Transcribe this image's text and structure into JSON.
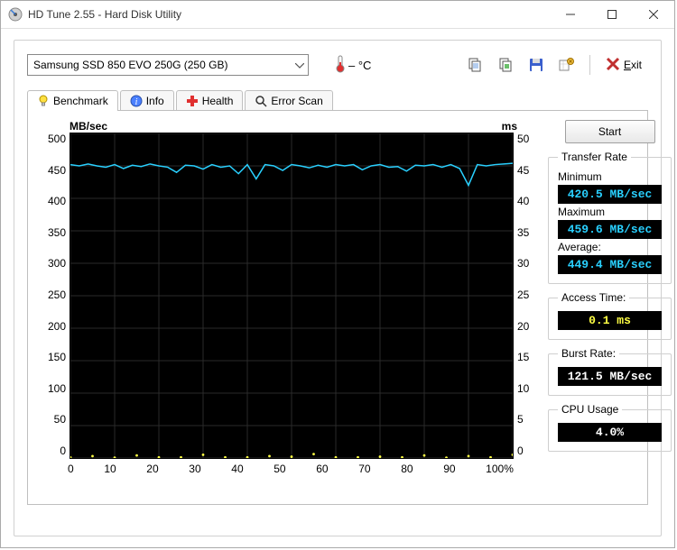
{
  "window": {
    "title": "HD Tune 2.55 - Hard Disk Utility"
  },
  "toolbar": {
    "drive_selected": "Samsung SSD 850 EVO 250G (250 GB)",
    "temperature": "– °C",
    "exit_label": "Exit"
  },
  "tabs": [
    {
      "id": "benchmark",
      "label": "Benchmark",
      "active": true
    },
    {
      "id": "info",
      "label": "Info",
      "active": false
    },
    {
      "id": "health",
      "label": "Health",
      "active": false
    },
    {
      "id": "errorscan",
      "label": "Error Scan",
      "active": false
    }
  ],
  "benchmark": {
    "start_label": "Start",
    "axis_left_label": "MB/sec",
    "axis_right_label": "ms",
    "y_left_ticks": [
      "500",
      "450",
      "400",
      "350",
      "300",
      "250",
      "200",
      "150",
      "100",
      "50",
      "0"
    ],
    "y_right_ticks": [
      "50",
      "45",
      "40",
      "35",
      "30",
      "25",
      "20",
      "15",
      "10",
      "5",
      "0"
    ],
    "x_ticks": [
      "0",
      "10",
      "20",
      "30",
      "40",
      "50",
      "60",
      "70",
      "80",
      "90",
      "100%"
    ],
    "groups": {
      "transfer": {
        "legend": "Transfer Rate",
        "min_label": "Minimum",
        "min_value": "420.5 MB/sec",
        "max_label": "Maximum",
        "max_value": "459.6 MB/sec",
        "avg_label": "Average:",
        "avg_value": "449.4 MB/sec"
      },
      "access": {
        "legend": "Access Time:",
        "value": "0.1 ms"
      },
      "burst": {
        "legend": "Burst Rate:",
        "value": "121.5 MB/sec"
      },
      "cpu": {
        "legend": "CPU Usage",
        "value": "4.0%"
      }
    }
  },
  "chart_data": {
    "type": "line",
    "title": "",
    "xlabel": "%",
    "ylabel_left": "MB/sec",
    "ylabel_right": "ms",
    "xlim": [
      0,
      100
    ],
    "ylim_left": [
      0,
      500
    ],
    "ylim_right": [
      0,
      50
    ],
    "series": [
      {
        "name": "Transfer Rate (MB/sec)",
        "axis": "left",
        "color": "#29d0ff",
        "x": [
          0,
          2,
          4,
          6,
          8,
          10,
          12,
          14,
          16,
          18,
          20,
          22,
          24,
          26,
          28,
          30,
          32,
          34,
          36,
          38,
          40,
          42,
          44,
          46,
          48,
          50,
          52,
          54,
          56,
          58,
          60,
          62,
          64,
          66,
          68,
          70,
          72,
          74,
          76,
          78,
          80,
          82,
          84,
          86,
          88,
          90,
          92,
          94,
          96,
          98,
          100
        ],
        "values": [
          452,
          450,
          453,
          450,
          448,
          452,
          446,
          451,
          449,
          453,
          450,
          448,
          440,
          451,
          450,
          445,
          452,
          448,
          450,
          438,
          452,
          430,
          452,
          450,
          443,
          452,
          450,
          447,
          451,
          448,
          452,
          450,
          452,
          444,
          450,
          452,
          448,
          449,
          442,
          451,
          450,
          452,
          448,
          452,
          446,
          420,
          452,
          450,
          452,
          453,
          454
        ]
      },
      {
        "name": "Access Time (ms)",
        "axis": "right",
        "color": "#ffff44",
        "x": [
          0,
          5,
          10,
          15,
          20,
          25,
          30,
          35,
          40,
          45,
          50,
          55,
          60,
          65,
          70,
          75,
          80,
          85,
          90,
          95,
          100
        ],
        "values": [
          0.1,
          0.3,
          0.05,
          0.4,
          0.1,
          0.1,
          0.5,
          0.1,
          0.1,
          0.3,
          0.2,
          0.6,
          0.1,
          0.1,
          0.2,
          0.1,
          0.4,
          0.05,
          0.3,
          0.1,
          0.5
        ]
      }
    ]
  }
}
